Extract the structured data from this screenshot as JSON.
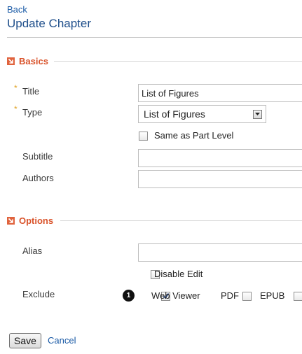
{
  "nav": {
    "back_label": "Back"
  },
  "page": {
    "title": "Update Chapter"
  },
  "sections": {
    "basics": "Basics",
    "options": "Options"
  },
  "form": {
    "title_label": "Title",
    "title_value": "List of Figures",
    "type_label": "Type",
    "type_value": "List of Figures",
    "same_as_part_label": "Same as Part Level",
    "same_as_part_checked": false,
    "subtitle_label": "Subtitle",
    "subtitle_value": "",
    "authors_label": "Authors",
    "authors_value": "",
    "alias_label": "Alias",
    "alias_value": "",
    "disable_edit_label": "Disable Edit",
    "disable_edit_checked": false,
    "exclude_label": "Exclude",
    "exclude_badge": "1",
    "exclude_options": [
      {
        "label": "Web Viewer",
        "checked": true
      },
      {
        "label": "PDF",
        "checked": false
      },
      {
        "label": "EPUB",
        "checked": false
      }
    ]
  },
  "actions": {
    "save_label": "Save",
    "cancel_label": "Cancel"
  },
  "colors": {
    "link": "#1a5aa6",
    "section_title": "#d9532b",
    "required_marker": "#e0a52a"
  }
}
